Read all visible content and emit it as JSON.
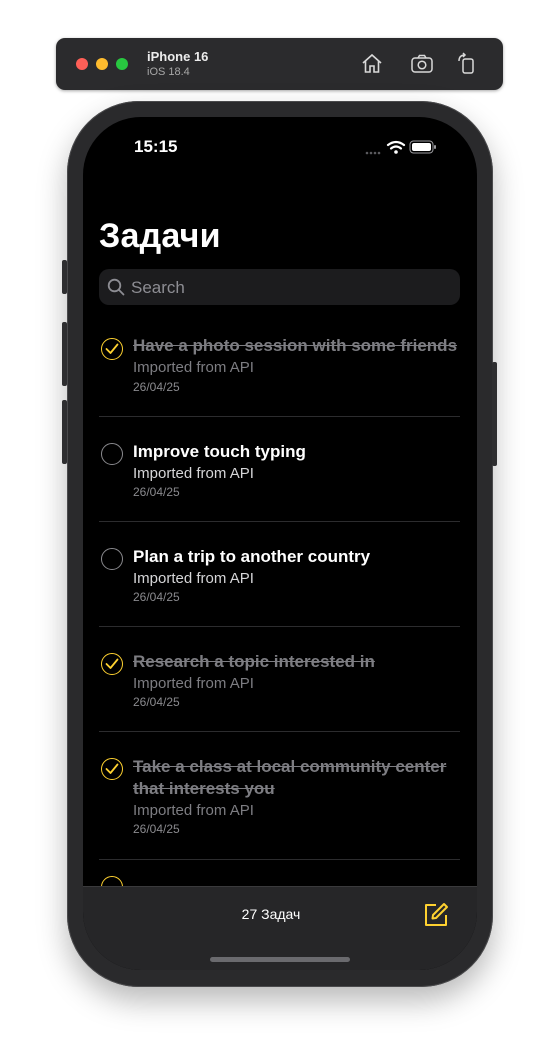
{
  "simulator": {
    "device_name": "iPhone 16",
    "os_version": "iOS 18.4",
    "icons": [
      "home-icon",
      "screenshot-icon",
      "rotate-icon"
    ]
  },
  "status_bar": {
    "time": "15:15",
    "icons": [
      "wifi-icon",
      "battery-icon"
    ]
  },
  "header": {
    "title": "Задачи"
  },
  "search": {
    "placeholder": "Search"
  },
  "tasks": [
    {
      "title": "Have a photo session with some friends",
      "source": "Imported from API",
      "date": "26/04/25",
      "completed": true
    },
    {
      "title": "Improve touch typing",
      "source": "Imported from API",
      "date": "26/04/25",
      "completed": false
    },
    {
      "title": "Plan a trip to another country",
      "source": "Imported from API",
      "date": "26/04/25",
      "completed": false
    },
    {
      "title": "Research a topic interested in",
      "source": "Imported from API",
      "date": "26/04/25",
      "completed": true
    },
    {
      "title": "Take a class at local community center that interests you",
      "source": "Imported from API",
      "date": "26/04/25",
      "completed": true
    }
  ],
  "bottom_bar": {
    "count_label": "27 Задач",
    "compose_icon": "compose-icon"
  },
  "colors": {
    "accent": "#fed130",
    "background": "#000000",
    "toolbar": "#262628"
  }
}
